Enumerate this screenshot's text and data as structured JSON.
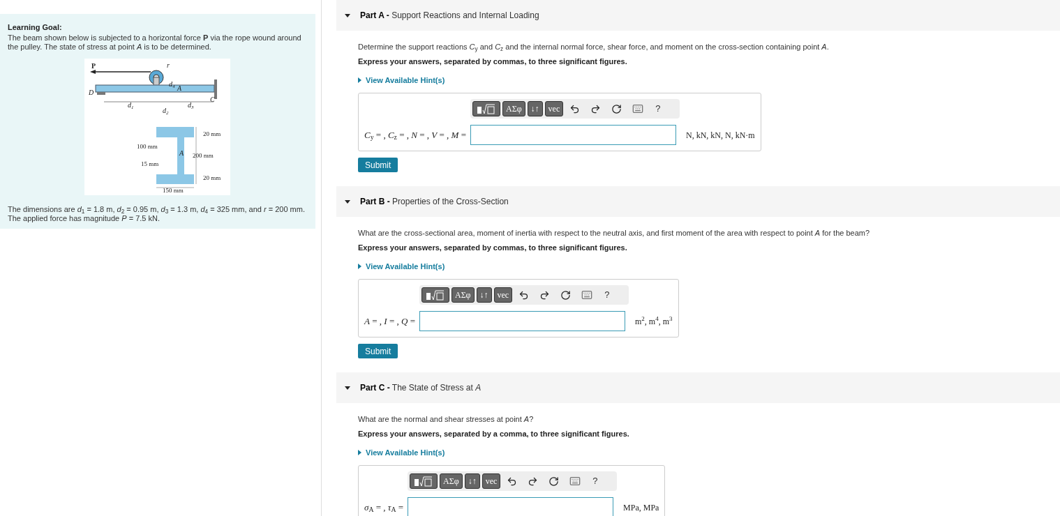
{
  "learning_goal": {
    "title": "Learning Goal:",
    "text": "The beam shown below is subjected to a horizontal force **P** via the rope wound around the pulley. The state of stress at point *A* is to be determined.",
    "figure": {
      "labels": [
        {
          "text": "P"
        },
        {
          "text": "r"
        },
        {
          "text": "d",
          "sub": "4"
        },
        {
          "text": "D"
        },
        {
          "text": "A"
        },
        {
          "text": "C"
        },
        {
          "text": "d",
          "sub": "1"
        },
        {
          "text": "d",
          "sub": "2"
        },
        {
          "text": "d",
          "sub": "3"
        },
        {
          "text": "20 mm"
        },
        {
          "text": "100 mm"
        },
        {
          "text": "A"
        },
        {
          "text": "200 mm"
        },
        {
          "text": "15 mm"
        },
        {
          "text": "20 mm"
        },
        {
          "text": "150 mm"
        }
      ]
    },
    "dimensions": "The dimensions are *d*$_{1}$ = 1.8 m, *d*$_{2}$ = 0.95 m, *d*$_{3}$ = 1.3 m, *d*$_{4}$ = 325 mm, and *r* = 200 mm. The applied force has magnitude *P* = 7.5 kN."
  },
  "parts": [
    {
      "label": "Part A -",
      "title": "Support Reactions and Internal Loading",
      "expanded": true,
      "question": "Determine the support reactions *C*$_{y}$ and *C*$_{z}$ and the internal normal force, shear force, and moment on the cross-section containing point *A*.",
      "instruction": "Express your answers, separated by commas, to three significant figures.",
      "hint": "View Available Hint(s)",
      "toolbar": [
        "ΑΣφ",
        "↓↑",
        "vec",
        "?"
      ],
      "answer_label": "*C*$_{y}$ = , *C*$_{z}$ = , *N* = , *V* = , *M* =",
      "units": "N, kN, kN, N, kN·m",
      "submit": "Submit"
    },
    {
      "label": "Part B -",
      "title": "Properties of the Cross-Section",
      "expanded": true,
      "question": "What are the cross-sectional area, moment of inertia with respect to the neutral axis, and first moment of the area with respect to point *A* for the beam?",
      "instruction": "Express your answers, separated by commas, to three significant figures.",
      "hint": "View Available Hint(s)",
      "toolbar": [
        "ΑΣφ",
        "↓↑",
        "vec",
        "?"
      ],
      "answer_label": "*A* = , *I* = , *Q* =",
      "units": "m$^{2}$, m$^{4}$, m$^{3}$",
      "submit": "Submit"
    },
    {
      "label": "Part C -",
      "title": "The State of Stress at *A*",
      "expanded": true,
      "question": "What are the normal and shear stresses at point *A*?",
      "instruction": "Express your answers, separated by a comma, to three significant figures.",
      "hint": "View Available Hint(s)",
      "toolbar": [
        "ΑΣφ",
        "↓↑",
        "vec",
        "?"
      ],
      "answer_label": "*σ*$_{A}$ = , *τ*$_{A}$ =",
      "units": "MPa, MPa"
    }
  ]
}
